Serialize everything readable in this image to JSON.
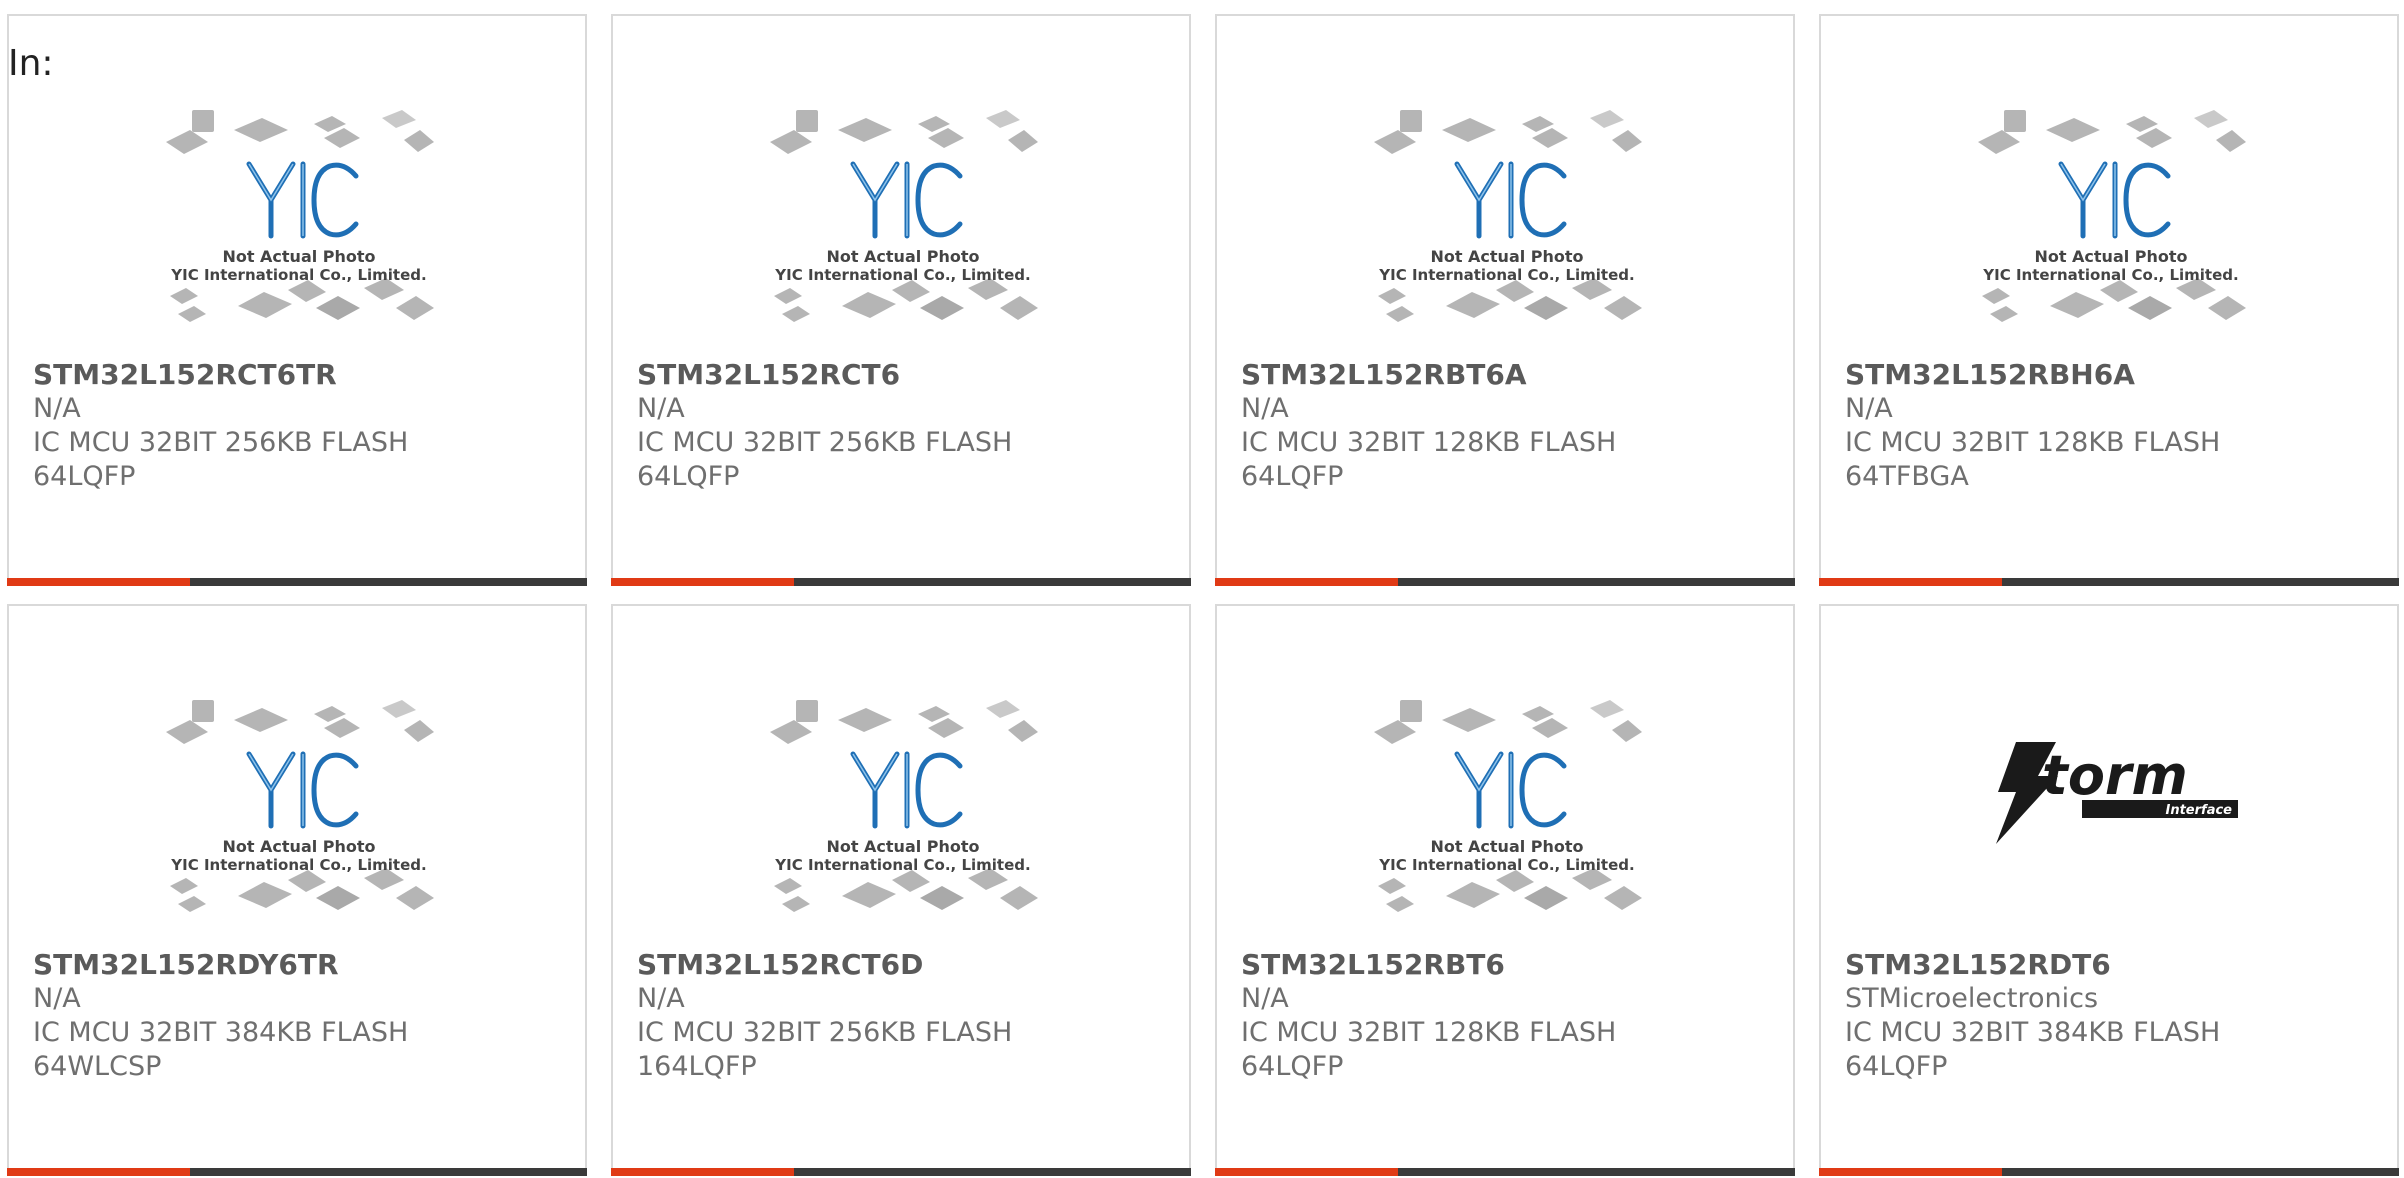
{
  "page": {
    "in_label": "In:"
  },
  "placeholder_image": {
    "logo_text": "YIC",
    "caption_line1": "Not Actual Photo",
    "caption_line2": "YIC International Co., Limited."
  },
  "storm_logo": {
    "word": "torm",
    "sub": "Interface"
  },
  "colors": {
    "accent": "#e03a15",
    "bar": "#3a3a3a",
    "logo_blue": "#1f6fb5"
  },
  "products": [
    {
      "part": "STM32L152RCT6TR",
      "maker": "N/A",
      "desc1": "IC MCU 32BIT 256KB FLASH",
      "desc2": "64LQFP",
      "image": "yic-placeholder"
    },
    {
      "part": "STM32L152RCT6",
      "maker": "N/A",
      "desc1": "IC MCU 32BIT 256KB FLASH",
      "desc2": "64LQFP",
      "image": "yic-placeholder"
    },
    {
      "part": "STM32L152RBT6A",
      "maker": "N/A",
      "desc1": "IC MCU 32BIT 128KB FLASH",
      "desc2": "64LQFP",
      "image": "yic-placeholder"
    },
    {
      "part": "STM32L152RBH6A",
      "maker": "N/A",
      "desc1": "IC MCU 32BIT 128KB FLASH",
      "desc2": "64TFBGA",
      "image": "yic-placeholder"
    },
    {
      "part": "STM32L152RDY6TR",
      "maker": "N/A",
      "desc1": "IC MCU 32BIT 384KB FLASH",
      "desc2": "64WLCSP",
      "image": "yic-placeholder"
    },
    {
      "part": "STM32L152RCT6D",
      "maker": "N/A",
      "desc1": "IC MCU 32BIT 256KB FLASH",
      "desc2": "164LQFP",
      "image": "yic-placeholder"
    },
    {
      "part": "STM32L152RBT6",
      "maker": "N/A",
      "desc1": "IC MCU 32BIT 128KB FLASH",
      "desc2": "64LQFP",
      "image": "yic-placeholder"
    },
    {
      "part": "STM32L152RDT6",
      "maker": "STMicroelectronics",
      "desc1": "IC MCU 32BIT 384KB FLASH",
      "desc2": "64LQFP",
      "image": "storm-interface-logo"
    }
  ]
}
